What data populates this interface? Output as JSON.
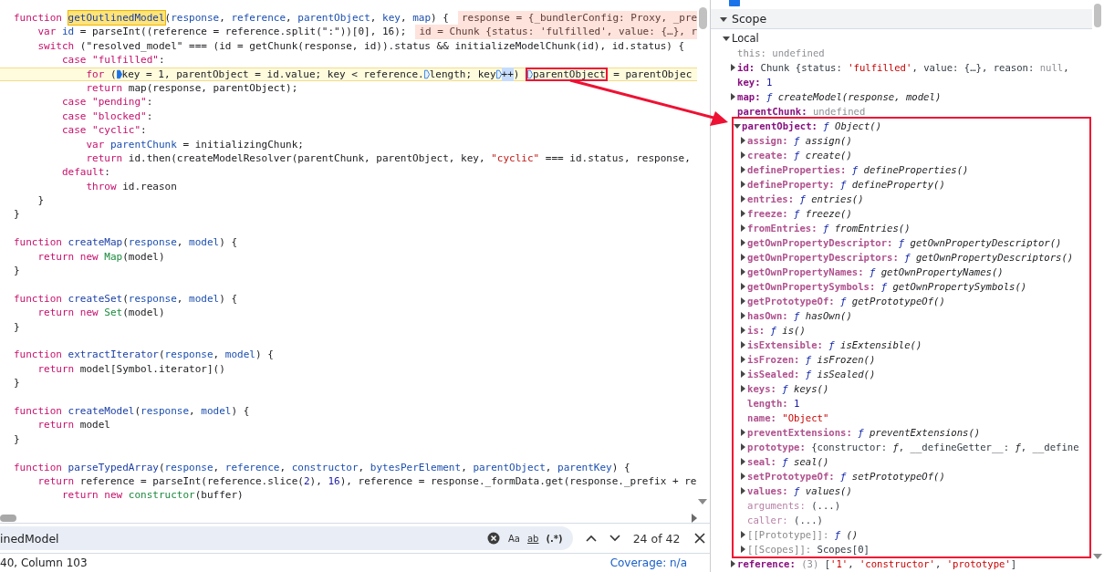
{
  "code": {
    "lines": [
      {
        "kind": "code",
        "inline_value": "response = {_bundlerConfig: Proxy, _pre",
        "tokens": [
          {
            "t": "function ",
            "kind": "keyword"
          },
          {
            "t": "getOutlinedModel",
            "kind": "definition",
            "search_match": true
          },
          {
            "t": "(",
            "kind": "plain"
          },
          {
            "t": "response",
            "kind": "variable"
          },
          {
            "t": ", ",
            "kind": "plain"
          },
          {
            "t": "reference",
            "kind": "variable"
          },
          {
            "t": ", ",
            "kind": "plain"
          },
          {
            "t": "parentObject",
            "kind": "variable"
          },
          {
            "t": ", ",
            "kind": "plain"
          },
          {
            "t": "key",
            "kind": "variable"
          },
          {
            "t": ", ",
            "kind": "plain"
          },
          {
            "t": "map",
            "kind": "variable"
          },
          {
            "t": ") {",
            "kind": "plain"
          }
        ]
      },
      {
        "kind": "code",
        "inline_value": "id = Chunk {status: 'fulfilled', value: {…}, r",
        "tokens": [
          {
            "t": "    var ",
            "kind": "keyword"
          },
          {
            "t": "id",
            "kind": "variable"
          },
          {
            "t": " = parseInt((reference = reference.split(\":\"))[0], 16);",
            "kind": "plain"
          }
        ]
      },
      {
        "kind": "code",
        "tokens": [
          {
            "t": "    switch ",
            "kind": "keyword"
          },
          {
            "t": "(\"resolved_model\" === (id = getChunk(response, id)).status && initializeModelChunk(id), id.status) {",
            "kind": "plain"
          }
        ]
      },
      {
        "kind": "code",
        "tokens": [
          {
            "t": "        case \"fulfilled\"",
            "kind": "keyword"
          },
          {
            "t": ":",
            "kind": "plain"
          }
        ]
      },
      {
        "kind": "code",
        "current": true,
        "tokens": [
          {
            "t": "            for ",
            "kind": "keyword"
          },
          {
            "t": "(",
            "kind": "plain"
          },
          {
            "t": "key = 1, parentObject = id.value; key < reference.",
            "kind": "plain",
            "breakpoint": true,
            "active": true
          },
          {
            "t": "length; key",
            "kind": "plain",
            "breakpoint": true,
            "active": false
          },
          {
            "t": "++",
            "kind": "plain",
            "breakpoint": true,
            "active": false,
            "step_target": true
          },
          {
            "t": ") ",
            "kind": "plain"
          },
          {
            "t": "parentObject",
            "kind": "plain",
            "breakpoint": true,
            "active": false,
            "boxed": true
          },
          {
            "t": " = parentObjec",
            "kind": "plain"
          }
        ]
      },
      {
        "kind": "code",
        "tokens": [
          {
            "t": "            return ",
            "kind": "keyword"
          },
          {
            "t": "map(response, parentObject);",
            "kind": "plain"
          }
        ]
      },
      {
        "kind": "code",
        "tokens": [
          {
            "t": "        case \"pending\"",
            "kind": "keyword"
          },
          {
            "t": ":",
            "kind": "plain"
          }
        ]
      },
      {
        "kind": "code",
        "tokens": [
          {
            "t": "        case \"blocked\"",
            "kind": "keyword"
          },
          {
            "t": ":",
            "kind": "plain"
          }
        ]
      },
      {
        "kind": "code",
        "tokens": [
          {
            "t": "        case \"cyclic\"",
            "kind": "keyword"
          },
          {
            "t": ":",
            "kind": "plain"
          }
        ]
      },
      {
        "kind": "code",
        "tokens": [
          {
            "t": "            var ",
            "kind": "keyword"
          },
          {
            "t": "parentChunk",
            "kind": "variable"
          },
          {
            "t": " = initializingChunk;",
            "kind": "plain"
          }
        ]
      },
      {
        "kind": "code",
        "tokens": [
          {
            "t": "            return ",
            "kind": "keyword"
          },
          {
            "t": "id.then(createModelResolver(parentChunk, parentObject, key, ",
            "kind": "plain"
          },
          {
            "t": "\"cyclic\"",
            "kind": "string"
          },
          {
            "t": " === id.status, response,",
            "kind": "plain"
          }
        ]
      },
      {
        "kind": "code",
        "tokens": [
          {
            "t": "        default",
            "kind": "keyword"
          },
          {
            "t": ":",
            "kind": "plain"
          }
        ]
      },
      {
        "kind": "code",
        "tokens": [
          {
            "t": "            throw ",
            "kind": "keyword"
          },
          {
            "t": "id.reason",
            "kind": "plain"
          }
        ]
      },
      {
        "kind": "code",
        "tokens": [
          {
            "t": "    }",
            "kind": "plain"
          }
        ]
      },
      {
        "kind": "code",
        "tokens": [
          {
            "t": "}",
            "kind": "plain"
          }
        ]
      },
      {
        "kind": "blank"
      },
      {
        "kind": "code",
        "tokens": [
          {
            "t": "function ",
            "kind": "keyword"
          },
          {
            "t": "createMap",
            "kind": "definition"
          },
          {
            "t": "(",
            "kind": "plain"
          },
          {
            "t": "response",
            "kind": "variable"
          },
          {
            "t": ", ",
            "kind": "plain"
          },
          {
            "t": "model",
            "kind": "variable"
          },
          {
            "t": ") {",
            "kind": "plain"
          }
        ]
      },
      {
        "kind": "code",
        "tokens": [
          {
            "t": "    return new ",
            "kind": "keyword"
          },
          {
            "t": "Map",
            "kind": "builtin"
          },
          {
            "t": "(model)",
            "kind": "plain"
          }
        ]
      },
      {
        "kind": "code",
        "tokens": [
          {
            "t": "}",
            "kind": "plain"
          }
        ]
      },
      {
        "kind": "blank"
      },
      {
        "kind": "code",
        "tokens": [
          {
            "t": "function ",
            "kind": "keyword"
          },
          {
            "t": "createSet",
            "kind": "definition"
          },
          {
            "t": "(",
            "kind": "plain"
          },
          {
            "t": "response",
            "kind": "variable"
          },
          {
            "t": ", ",
            "kind": "plain"
          },
          {
            "t": "model",
            "kind": "variable"
          },
          {
            "t": ") {",
            "kind": "plain"
          }
        ]
      },
      {
        "kind": "code",
        "tokens": [
          {
            "t": "    return new ",
            "kind": "keyword"
          },
          {
            "t": "Set",
            "kind": "builtin"
          },
          {
            "t": "(model)",
            "kind": "plain"
          }
        ]
      },
      {
        "kind": "code",
        "tokens": [
          {
            "t": "}",
            "kind": "plain"
          }
        ]
      },
      {
        "kind": "blank"
      },
      {
        "kind": "code",
        "tokens": [
          {
            "t": "function ",
            "kind": "keyword"
          },
          {
            "t": "extractIterator",
            "kind": "definition"
          },
          {
            "t": "(",
            "kind": "plain"
          },
          {
            "t": "response",
            "kind": "variable"
          },
          {
            "t": ", ",
            "kind": "plain"
          },
          {
            "t": "model",
            "kind": "variable"
          },
          {
            "t": ") {",
            "kind": "plain"
          }
        ]
      },
      {
        "kind": "code",
        "tokens": [
          {
            "t": "    return ",
            "kind": "keyword"
          },
          {
            "t": "model[Symbol.iterator]()",
            "kind": "plain"
          }
        ]
      },
      {
        "kind": "code",
        "tokens": [
          {
            "t": "}",
            "kind": "plain"
          }
        ]
      },
      {
        "kind": "blank"
      },
      {
        "kind": "code",
        "tokens": [
          {
            "t": "function ",
            "kind": "keyword"
          },
          {
            "t": "createModel",
            "kind": "definition"
          },
          {
            "t": "(",
            "kind": "plain"
          },
          {
            "t": "response",
            "kind": "variable"
          },
          {
            "t": ", ",
            "kind": "plain"
          },
          {
            "t": "model",
            "kind": "variable"
          },
          {
            "t": ") {",
            "kind": "plain"
          }
        ]
      },
      {
        "kind": "code",
        "tokens": [
          {
            "t": "    return ",
            "kind": "keyword"
          },
          {
            "t": "model",
            "kind": "plain"
          }
        ]
      },
      {
        "kind": "code",
        "tokens": [
          {
            "t": "}",
            "kind": "plain"
          }
        ]
      },
      {
        "kind": "blank"
      },
      {
        "kind": "code",
        "tokens": [
          {
            "t": "function ",
            "kind": "keyword"
          },
          {
            "t": "parseTypedArray",
            "kind": "definition"
          },
          {
            "t": "(",
            "kind": "plain"
          },
          {
            "t": "response",
            "kind": "variable"
          },
          {
            "t": ", ",
            "kind": "plain"
          },
          {
            "t": "reference",
            "kind": "variable"
          },
          {
            "t": ", ",
            "kind": "plain"
          },
          {
            "t": "constructor",
            "kind": "variable"
          },
          {
            "t": ", ",
            "kind": "plain"
          },
          {
            "t": "bytesPerElement",
            "kind": "variable"
          },
          {
            "t": ", ",
            "kind": "plain"
          },
          {
            "t": "parentObject",
            "kind": "variable"
          },
          {
            "t": ", ",
            "kind": "plain"
          },
          {
            "t": "parentKey",
            "kind": "variable"
          },
          {
            "t": ") {",
            "kind": "plain"
          }
        ]
      },
      {
        "kind": "code",
        "tokens": [
          {
            "t": "    return ",
            "kind": "keyword"
          },
          {
            "t": "reference = parseInt(reference.slice(",
            "kind": "plain"
          },
          {
            "t": "2",
            "kind": "number"
          },
          {
            "t": "), ",
            "kind": "plain"
          },
          {
            "t": "16",
            "kind": "number"
          },
          {
            "t": "), reference = response._formData.get(response._prefix + re",
            "kind": "plain"
          }
        ]
      },
      {
        "kind": "code",
        "tokens": [
          {
            "t": "        return new ",
            "kind": "keyword"
          },
          {
            "t": "constructor",
            "kind": "builtin"
          },
          {
            "t": "(buffer)",
            "kind": "plain"
          }
        ]
      }
    ]
  },
  "search": {
    "value": "inedModel",
    "options": [
      {
        "label": "Aa",
        "kind": "case",
        "selected": false
      },
      {
        "label": "ab",
        "kind": "word",
        "selected": false
      },
      {
        "label": "(.*)",
        "kind": "regex",
        "selected": false
      }
    ],
    "count": "24 of 42"
  },
  "status_bar": {
    "position": "40, Column 103",
    "coverage": "Coverage: n/a"
  },
  "call_frame": {
    "checked": true
  },
  "scope": {
    "title": "Scope",
    "expanded": true,
    "sections": [
      {
        "title": "Local",
        "expanded": true,
        "items": [
          {
            "name": "this:",
            "internal": true,
            "kind": "leaf",
            "value": [
              {
                "t": "undefined",
                "kind": "dim"
              }
            ]
          },
          {
            "name": "id:",
            "enumerable": true,
            "kind": "node",
            "expanded": false,
            "value": [
              {
                "t": "Chunk {status: ",
                "kind": "text"
              },
              {
                "t": "'fulfilled'",
                "kind": "string"
              },
              {
                "t": ", value: {…}, reason: ",
                "kind": "text"
              },
              {
                "t": "null",
                "kind": "dim"
              },
              {
                "t": ",",
                "kind": "text"
              }
            ]
          },
          {
            "name": "key:",
            "enumerable": true,
            "kind": "leaf",
            "value": [
              {
                "t": "1",
                "kind": "number"
              }
            ]
          },
          {
            "name": "map:",
            "enumerable": true,
            "kind": "node",
            "expanded": false,
            "value": [
              {
                "t": "ƒ",
                "kind": "function"
              },
              {
                "t": " createModel(response, model)",
                "kind": "italic"
              }
            ]
          },
          {
            "name": "parentChunk:",
            "enumerable": true,
            "kind": "leaf",
            "value": [
              {
                "t": "undefined",
                "kind": "dim"
              }
            ]
          },
          {
            "name": "parentObject:",
            "enumerable": true,
            "kind": "node",
            "expanded": true,
            "framed": true,
            "value": [
              {
                "t": "ƒ",
                "kind": "function"
              },
              {
                "t": " Object()",
                "kind": "italic"
              }
            ],
            "children": [
              {
                "name": "assign:",
                "enumerable": false,
                "kind": "node",
                "expanded": false,
                "value": [
                  {
                    "t": "ƒ",
                    "kind": "function"
                  },
                  {
                    "t": " assign()",
                    "kind": "italic"
                  }
                ]
              },
              {
                "name": "create:",
                "enumerable": false,
                "kind": "node",
                "expanded": false,
                "value": [
                  {
                    "t": "ƒ",
                    "kind": "function"
                  },
                  {
                    "t": " create()",
                    "kind": "italic"
                  }
                ]
              },
              {
                "name": "defineProperties:",
                "enumerable": false,
                "kind": "node",
                "expanded": false,
                "value": [
                  {
                    "t": "ƒ",
                    "kind": "function"
                  },
                  {
                    "t": " defineProperties()",
                    "kind": "italic"
                  }
                ]
              },
              {
                "name": "defineProperty:",
                "enumerable": false,
                "kind": "node",
                "expanded": false,
                "value": [
                  {
                    "t": "ƒ",
                    "kind": "function"
                  },
                  {
                    "t": " defineProperty()",
                    "kind": "italic"
                  }
                ]
              },
              {
                "name": "entries:",
                "enumerable": false,
                "kind": "node",
                "expanded": false,
                "value": [
                  {
                    "t": "ƒ",
                    "kind": "function"
                  },
                  {
                    "t": " entries()",
                    "kind": "italic"
                  }
                ]
              },
              {
                "name": "freeze:",
                "enumerable": false,
                "kind": "node",
                "expanded": false,
                "value": [
                  {
                    "t": "ƒ",
                    "kind": "function"
                  },
                  {
                    "t": " freeze()",
                    "kind": "italic"
                  }
                ]
              },
              {
                "name": "fromEntries:",
                "enumerable": false,
                "kind": "node",
                "expanded": false,
                "value": [
                  {
                    "t": "ƒ",
                    "kind": "function"
                  },
                  {
                    "t": " fromEntries()",
                    "kind": "italic"
                  }
                ]
              },
              {
                "name": "getOwnPropertyDescriptor:",
                "enumerable": false,
                "kind": "node",
                "expanded": false,
                "value": [
                  {
                    "t": "ƒ",
                    "kind": "function"
                  },
                  {
                    "t": " getOwnPropertyDescriptor()",
                    "kind": "italic"
                  }
                ]
              },
              {
                "name": "getOwnPropertyDescriptors:",
                "enumerable": false,
                "kind": "node",
                "expanded": false,
                "value": [
                  {
                    "t": "ƒ",
                    "kind": "function"
                  },
                  {
                    "t": " getOwnPropertyDescriptors()",
                    "kind": "italic"
                  }
                ]
              },
              {
                "name": "getOwnPropertyNames:",
                "enumerable": false,
                "kind": "node",
                "expanded": false,
                "value": [
                  {
                    "t": "ƒ",
                    "kind": "function"
                  },
                  {
                    "t": " getOwnPropertyNames()",
                    "kind": "italic"
                  }
                ]
              },
              {
                "name": "getOwnPropertySymbols:",
                "enumerable": false,
                "kind": "node",
                "expanded": false,
                "value": [
                  {
                    "t": "ƒ",
                    "kind": "function"
                  },
                  {
                    "t": " getOwnPropertySymbols()",
                    "kind": "italic"
                  }
                ]
              },
              {
                "name": "getPrototypeOf:",
                "enumerable": false,
                "kind": "node",
                "expanded": false,
                "value": [
                  {
                    "t": "ƒ",
                    "kind": "function"
                  },
                  {
                    "t": " getPrototypeOf()",
                    "kind": "italic"
                  }
                ]
              },
              {
                "name": "hasOwn:",
                "enumerable": false,
                "kind": "node",
                "expanded": false,
                "value": [
                  {
                    "t": "ƒ",
                    "kind": "function"
                  },
                  {
                    "t": " hasOwn()",
                    "kind": "italic"
                  }
                ]
              },
              {
                "name": "is:",
                "enumerable": false,
                "kind": "node",
                "expanded": false,
                "value": [
                  {
                    "t": "ƒ",
                    "kind": "function"
                  },
                  {
                    "t": " is()",
                    "kind": "italic"
                  }
                ]
              },
              {
                "name": "isExtensible:",
                "enumerable": false,
                "kind": "node",
                "expanded": false,
                "value": [
                  {
                    "t": "ƒ",
                    "kind": "function"
                  },
                  {
                    "t": " isExtensible()",
                    "kind": "italic"
                  }
                ]
              },
              {
                "name": "isFrozen:",
                "enumerable": false,
                "kind": "node",
                "expanded": false,
                "value": [
                  {
                    "t": "ƒ",
                    "kind": "function"
                  },
                  {
                    "t": " isFrozen()",
                    "kind": "italic"
                  }
                ]
              },
              {
                "name": "isSealed:",
                "enumerable": false,
                "kind": "node",
                "expanded": false,
                "value": [
                  {
                    "t": "ƒ",
                    "kind": "function"
                  },
                  {
                    "t": " isSealed()",
                    "kind": "italic"
                  }
                ]
              },
              {
                "name": "keys:",
                "enumerable": false,
                "kind": "node",
                "expanded": false,
                "value": [
                  {
                    "t": "ƒ",
                    "kind": "function"
                  },
                  {
                    "t": " keys()",
                    "kind": "italic"
                  }
                ]
              },
              {
                "name": "length:",
                "enumerable": false,
                "kind": "leaf",
                "value": [
                  {
                    "t": "1",
                    "kind": "number"
                  }
                ]
              },
              {
                "name": "name:",
                "enumerable": false,
                "kind": "leaf",
                "value": [
                  {
                    "t": "\"Object\"",
                    "kind": "string"
                  }
                ]
              },
              {
                "name": "preventExtensions:",
                "enumerable": false,
                "kind": "node",
                "expanded": false,
                "value": [
                  {
                    "t": "ƒ",
                    "kind": "function"
                  },
                  {
                    "t": " preventExtensions()",
                    "kind": "italic"
                  }
                ]
              },
              {
                "name": "prototype:",
                "enumerable": false,
                "kind": "node",
                "expanded": false,
                "value": [
                  {
                    "t": "{constructor: ",
                    "kind": "text"
                  },
                  {
                    "t": "ƒ",
                    "kind": "italic"
                  },
                  {
                    "t": ", __defineGetter__: ",
                    "kind": "text"
                  },
                  {
                    "t": "ƒ",
                    "kind": "italic"
                  },
                  {
                    "t": ", __define",
                    "kind": "text"
                  }
                ]
              },
              {
                "name": "seal:",
                "enumerable": false,
                "kind": "node",
                "expanded": false,
                "value": [
                  {
                    "t": "ƒ",
                    "kind": "function"
                  },
                  {
                    "t": " seal()",
                    "kind": "italic"
                  }
                ]
              },
              {
                "name": "setPrototypeOf:",
                "enumerable": false,
                "kind": "node",
                "expanded": false,
                "value": [
                  {
                    "t": "ƒ",
                    "kind": "function"
                  },
                  {
                    "t": " setPrototypeOf()",
                    "kind": "italic"
                  }
                ]
              },
              {
                "name": "values:",
                "enumerable": false,
                "kind": "node",
                "expanded": false,
                "value": [
                  {
                    "t": "ƒ",
                    "kind": "function"
                  },
                  {
                    "t": " values()",
                    "kind": "italic"
                  }
                ]
              },
              {
                "name": "arguments:",
                "accessor": true,
                "kind": "leaf",
                "value": [
                  {
                    "t": "(...)",
                    "kind": "text"
                  }
                ]
              },
              {
                "name": "caller:",
                "accessor": true,
                "kind": "leaf",
                "value": [
                  {
                    "t": "(...)",
                    "kind": "text"
                  }
                ]
              },
              {
                "name": "[[Prototype]]:",
                "internal": true,
                "kind": "node",
                "expanded": false,
                "value": [
                  {
                    "t": "ƒ",
                    "kind": "function"
                  },
                  {
                    "t": " ()",
                    "kind": "italic"
                  }
                ]
              },
              {
                "name": "[[Scopes]]:",
                "internal": true,
                "kind": "node",
                "expanded": false,
                "value": [
                  {
                    "t": "Scopes[0]",
                    "kind": "text"
                  }
                ]
              }
            ]
          },
          {
            "name": "reference:",
            "enumerable": true,
            "kind": "node",
            "expanded": false,
            "value": [
              {
                "t": "(3) ",
                "kind": "dim"
              },
              {
                "t": "[",
                "kind": "text"
              },
              {
                "t": "'1'",
                "kind": "string"
              },
              {
                "t": ", ",
                "kind": "text"
              },
              {
                "t": "'constructor'",
                "kind": "string"
              },
              {
                "t": ", ",
                "kind": "text"
              },
              {
                "t": "'prototype'",
                "kind": "string"
              },
              {
                "t": "]",
                "kind": "text"
              }
            ]
          }
        ]
      }
    ]
  }
}
